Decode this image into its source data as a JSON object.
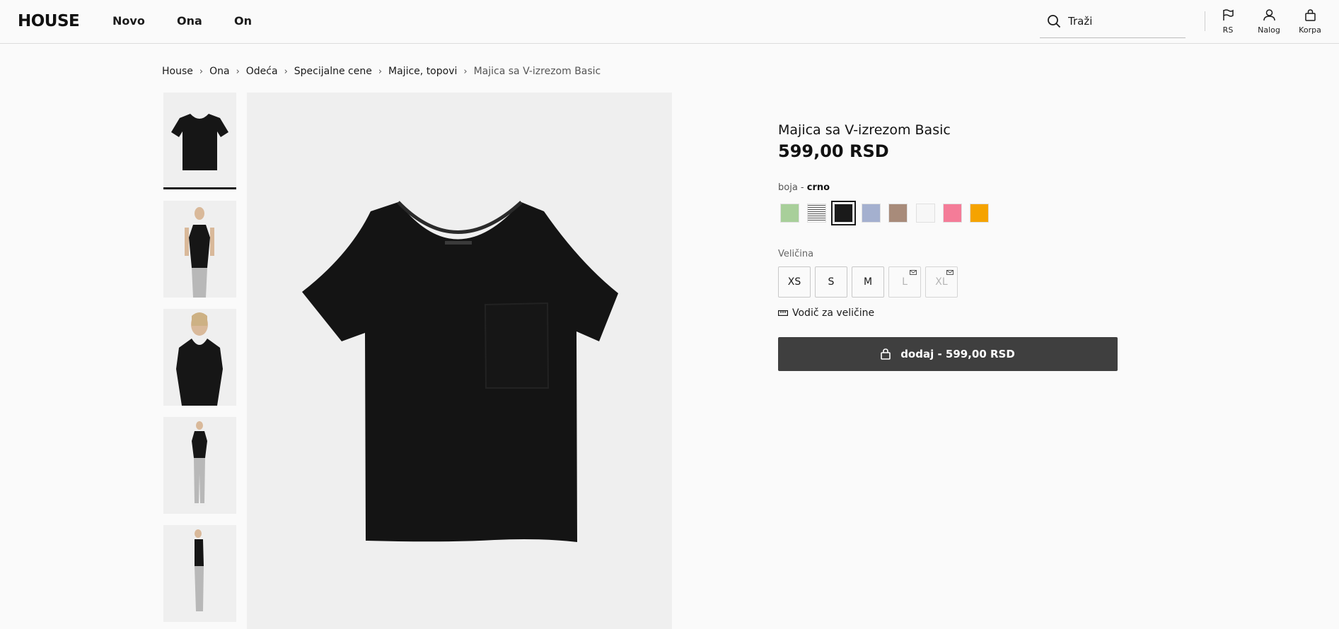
{
  "header": {
    "logo": "HOUSE",
    "nav": [
      "Novo",
      "Ona",
      "On"
    ],
    "search_placeholder": "Traži",
    "region_label": "RS",
    "account_label": "Nalog",
    "cart_label": "Korpa"
  },
  "breadcrumb": [
    "House",
    "Ona",
    "Odeća",
    "Specijalne cene",
    "Majice, topovi",
    "Majica sa V-izrezom Basic"
  ],
  "product": {
    "title": "Majica sa V-izrezom Basic",
    "price": "599,00 RSD",
    "color_label": "boja - ",
    "color_value": "crno",
    "swatches": [
      {
        "name": "green",
        "color": "#a8cf9a"
      },
      {
        "name": "striped",
        "color": "#f5f5f5"
      },
      {
        "name": "black",
        "color": "#1a1a1a",
        "selected": true
      },
      {
        "name": "light-blue",
        "color": "#a4b0cf"
      },
      {
        "name": "brown",
        "color": "#a88b7a"
      },
      {
        "name": "white",
        "color": "#f7f7f7"
      },
      {
        "name": "pink",
        "color": "#f47c98"
      },
      {
        "name": "orange",
        "color": "#f5a300"
      }
    ],
    "size_label": "Veličina",
    "sizes": [
      {
        "label": "XS",
        "available": true
      },
      {
        "label": "S",
        "available": true
      },
      {
        "label": "M",
        "available": true
      },
      {
        "label": "L",
        "available": false
      },
      {
        "label": "XL",
        "available": false
      }
    ],
    "size_guide": "Vodič za veličine",
    "add_button": "dodaj - 599,00 RSD"
  }
}
